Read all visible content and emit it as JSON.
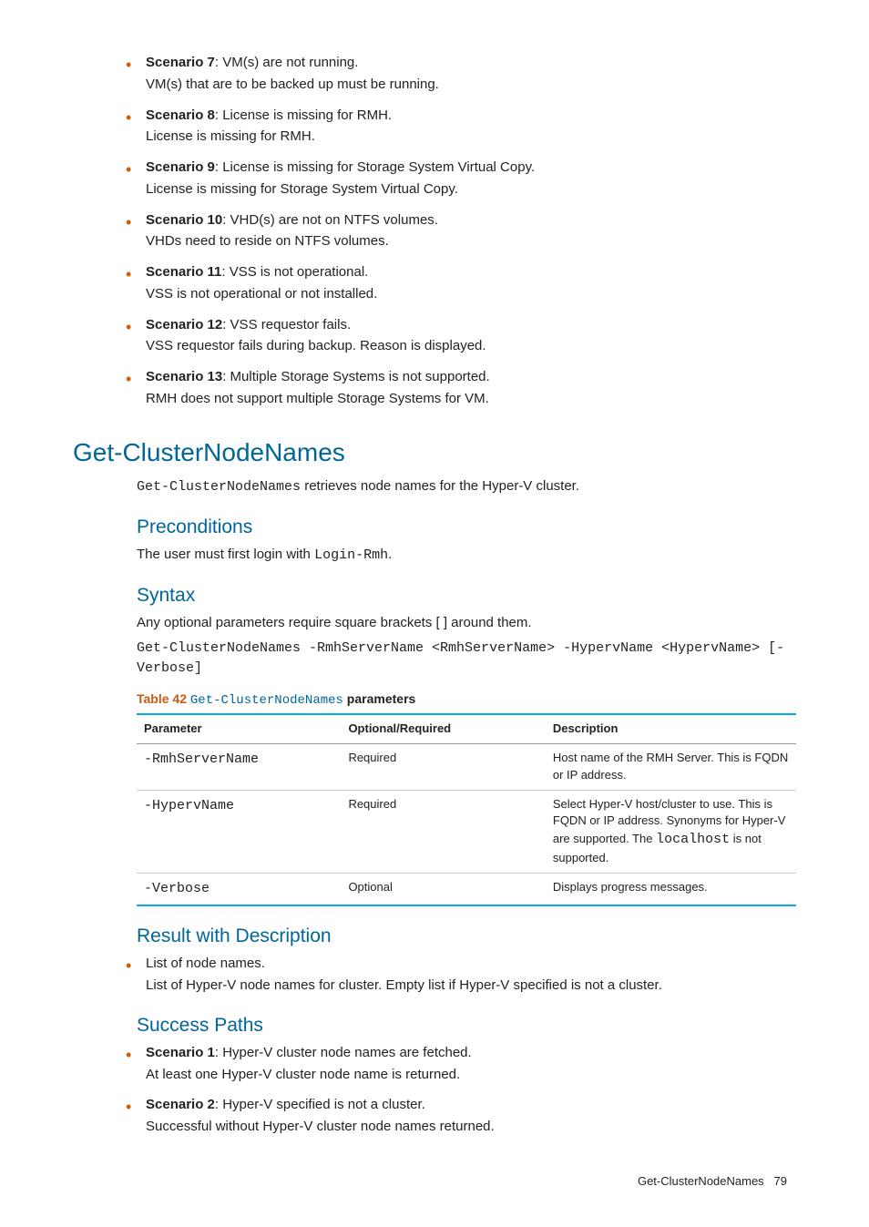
{
  "scenarios_top": [
    {
      "label": "Scenario 7",
      "title": ": VM(s) are not running.",
      "desc": "VM(s) that are to be backed up must be running."
    },
    {
      "label": "Scenario 8",
      "title": ": License is missing for RMH.",
      "desc": "License is missing for RMH."
    },
    {
      "label": "Scenario 9",
      "title": ": License is missing for Storage System Virtual Copy.",
      "desc": "License is missing for Storage System Virtual Copy."
    },
    {
      "label": "Scenario 10",
      "title": ": VHD(s) are not on NTFS volumes.",
      "desc": "VHDs need to reside on NTFS volumes."
    },
    {
      "label": "Scenario 11",
      "title": ": VSS is not operational.",
      "desc": "VSS is not operational or not installed."
    },
    {
      "label": "Scenario 12",
      "title": ": VSS requestor fails.",
      "desc": "VSS requestor fails during backup. Reason is displayed."
    },
    {
      "label": "Scenario 13",
      "title": ": Multiple Storage Systems is not supported.",
      "desc": "RMH does not support multiple Storage Systems for VM."
    }
  ],
  "section_title": "Get-ClusterNodeNames",
  "section_intro_code": "Get-ClusterNodeNames",
  "section_intro_rest": " retrieves node names for the Hyper-V cluster.",
  "preconditions_heading": "Preconditions",
  "preconditions_text_pre": "The user must first login with ",
  "preconditions_code": "Login-Rmh",
  "preconditions_text_post": ".",
  "syntax_heading": "Syntax",
  "syntax_intro": "Any optional parameters require square brackets [ ] around them.",
  "syntax_code": "Get-ClusterNodeNames -RmhServerName <RmhServerName> -HypervName <HypervName> [-Verbose]",
  "table_caption_label": "Table 42 ",
  "table_caption_code": "Get-ClusterNodeNames",
  "table_caption_params": " parameters",
  "table_headers": {
    "param": "Parameter",
    "optreq": "Optional/Required",
    "desc": "Description"
  },
  "table_rows": [
    {
      "param": "-RmhServerName",
      "optreq": "Required",
      "desc": "Host name of the RMH Server. This is FQDN or IP address."
    },
    {
      "param": "-HypervName",
      "optreq": "Required",
      "desc_pre": "Select Hyper-V host/cluster to use. This is FQDN or IP address. Synonyms for Hyper-V are supported. The ",
      "desc_code": "localhost",
      "desc_post": " is not supported."
    },
    {
      "param": "-Verbose",
      "optreq": "Optional",
      "desc": "Displays progress messages."
    }
  ],
  "result_heading": "Result with Description",
  "result_item_title": "List of node names.",
  "result_item_desc": "List of Hyper-V node names for cluster. Empty list if Hyper-V specified is not a cluster.",
  "success_heading": "Success Paths",
  "success_items": [
    {
      "label": "Scenario 1",
      "title": ": Hyper-V cluster node names are fetched.",
      "desc": "At least one Hyper-V cluster node name is returned."
    },
    {
      "label": "Scenario 2",
      "title": ": Hyper-V specified is not a cluster.",
      "desc": "Successful without Hyper-V cluster node names returned."
    }
  ],
  "footer_title": "Get-ClusterNodeNames",
  "footer_page": "79"
}
